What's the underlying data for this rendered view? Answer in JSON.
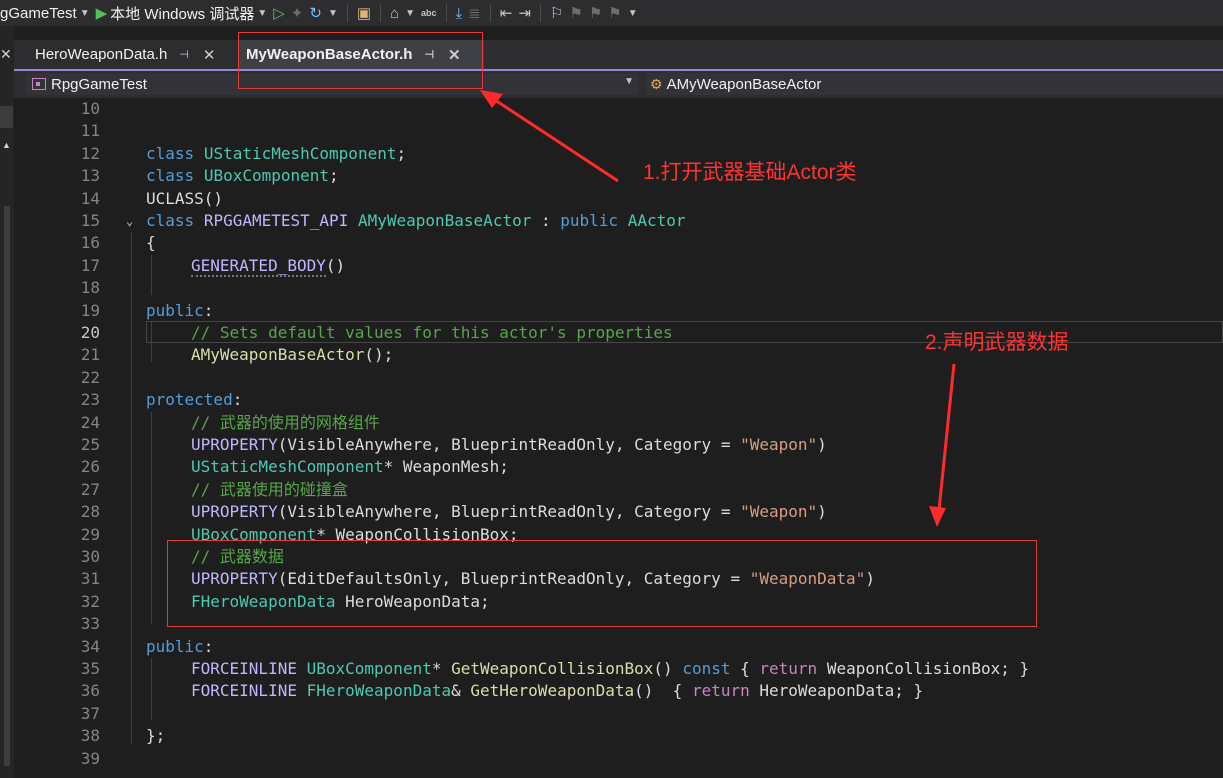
{
  "toolbar": {
    "project": "gGameTest",
    "debugger": "本地 Windows 调试器",
    "spellcheck": "abc",
    "icons": [
      "caret-down-icon",
      "play-icon",
      "caret-down-icon",
      "run-hollow-icon",
      "hot-reload-icon",
      "refresh-icon",
      "caret-down-icon",
      "folder-icon",
      "view-icon",
      "caret-down-icon",
      "spellcheck-icon",
      "step-icon",
      "format-icon",
      "outdent-icon",
      "indent-icon",
      "bookmark-icon",
      "bookmark-prev-icon",
      "bookmark-next-icon",
      "bookmark-clear-icon",
      "overflow-caret-icon"
    ]
  },
  "tabs": [
    {
      "label": "HeroWeaponData.h",
      "active": false
    },
    {
      "label": "MyWeaponBaseActor.h",
      "active": true
    }
  ],
  "navbar": {
    "project": "RpgGameTest",
    "class": "AMyWeaponBaseActor"
  },
  "code": {
    "line_numbers": [
      "10",
      "11",
      "12",
      "13",
      "14",
      "15",
      "16",
      "17",
      "18",
      "19",
      "20",
      "21",
      "22",
      "23",
      "24",
      "25",
      "26",
      "27",
      "28",
      "29",
      "30",
      "31",
      "32",
      "33",
      "34",
      "35",
      "36",
      "37",
      "38",
      "39"
    ],
    "current_line": "20",
    "l12": {
      "kw": "class",
      "type": "UStaticMeshComponent",
      "end": ";"
    },
    "l13": {
      "kw": "class",
      "type": "UBoxComponent",
      "end": ";"
    },
    "l14": {
      "macro": "UCLASS",
      "end": "()"
    },
    "l15": {
      "kw": "class",
      "api": "RPGGAMETEST_API",
      "name": "AMyWeaponBaseActor",
      "colon": ":",
      "access": "public",
      "base": "AActor"
    },
    "l16": "{",
    "l17": {
      "macro": "GENERATED_BODY",
      "end": "()"
    },
    "l19": {
      "kw": "public",
      "end": ":"
    },
    "l20": "// Sets default values for this actor's properties",
    "l21": {
      "fn": "AMyWeaponBaseActor",
      "end": "();"
    },
    "l23": {
      "kw": "protected",
      "end": ":"
    },
    "l24": "// 武器的使用的网格组件",
    "l25": {
      "macro": "UPROPERTY",
      "args": "(VisibleAnywhere, BlueprintReadOnly, Category = ",
      "str": "\"Weapon\"",
      "end": ")"
    },
    "l26": {
      "type": "UStaticMeshComponent",
      "rest": "* WeaponMesh;"
    },
    "l27": "// 武器使用的碰撞盒",
    "l28": {
      "macro": "UPROPERTY",
      "args": "(VisibleAnywhere, BlueprintReadOnly, Category = ",
      "str": "\"Weapon\"",
      "end": ")"
    },
    "l29": {
      "type": "UBoxComponent",
      "rest": "* WeaponCollisionBox;"
    },
    "l30": "// 武器数据",
    "l31": {
      "macro": "UPROPERTY",
      "args": "(EditDefaultsOnly, BlueprintReadOnly, Category = ",
      "str": "\"WeaponData\"",
      "end": ")"
    },
    "l32": {
      "type": "FHeroWeaponData",
      "rest": " HeroWeaponData;"
    },
    "l34": {
      "kw": "public",
      "end": ":"
    },
    "l35": {
      "macro": "FORCEINLINE",
      "type": "UBoxComponent",
      "mid": "* ",
      "fn": "GetWeaponCollisionBox",
      "paren": "() ",
      "const": "const",
      "open": " { ",
      "ret": "return",
      "tail": " WeaponCollisionBox; }"
    },
    "l36": {
      "macro": "FORCEINLINE",
      "type": "FHeroWeaponData",
      "mid": "& ",
      "fn": "GetHeroWeaponData",
      "paren": "()  ",
      "open": "{ ",
      "ret": "return",
      "tail": " HeroWeaponData; }"
    },
    "l38": "};"
  },
  "annotations": {
    "a1": "1.打开武器基础Actor类",
    "a2": "2.声明武器数据",
    "color": "#ff3333"
  }
}
